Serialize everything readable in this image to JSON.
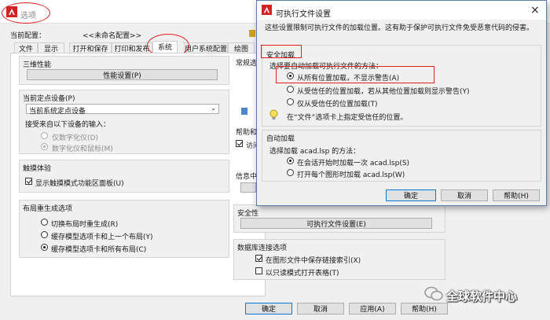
{
  "options": {
    "title": "选项",
    "profile_label": "当前配置：",
    "profile_value": "<<未命名配置>>",
    "tabs": [
      "文件",
      "显示",
      "打开和保存",
      "打印和发布",
      "系统",
      "用户系统配置",
      "绘图"
    ],
    "perf_group": "三维性能",
    "perf_btn": "性能设置(P)",
    "pointer_group": "当前定点设备(P)",
    "pointer_select": "当前系统定点设备",
    "accept_label": "接受来自以下设备的输入：",
    "digitizer_only": "仅数字化仪(D)",
    "digitizer_mouse": "数字化仪和鼠标(M)",
    "touch_group": "触摸体验",
    "touch_check": "显示触摸模式功能区面板(U)",
    "layout_group": "布局重生成选项",
    "layout_opt1": "切换布局时重生成(R)",
    "layout_opt2": "缓存模型选项卡和上一个布局(Y)",
    "layout_opt3": "缓存模型选项卡和所有布局(C)",
    "right_general": "常规选",
    "right_help": "帮助和",
    "right_access": "访问",
    "right_info": "信息中",
    "security_group": "安全性",
    "security_btn": "可执行文件设置(E)",
    "db_group": "数据库连接选项",
    "db_opt1": "在图形文件中保存链接索引(X)",
    "db_opt2": "以只读模式打开表格(T)",
    "ok": "确定",
    "cancel": "取消",
    "apply": "应用(A)",
    "help": "帮助(H)"
  },
  "exec_dialog": {
    "title": "可执行文件设置",
    "close": "×",
    "desc": "这些设置限制可执行文件的加载位置。这有助于保护可执行文件免受恶意代码的侵害。",
    "security_heading": "安全加载",
    "select_label": "选择要自动加载可执行文件的方法：",
    "opt1": "从所有位置加载，不显示警告(A)",
    "opt2": "从受信任的位置加载，若从其他位置加载则显示警告(Y)",
    "opt3": "仅从受信任的位置加载(T)",
    "hint": "在“文件”选项卡上指定受信任的位置。",
    "autoload_heading": "自动加载",
    "autoload_label": "选择加载 acad.lsp 的方法：",
    "autoload_opt1": "在会话开始时加载一次 acad.lsp(S)",
    "autoload_opt2": "打开每个图形时加载 acad.lsp(W)",
    "ok": "确定",
    "cancel": "取消",
    "help": "帮助(H)"
  },
  "watermark": {
    "text": "全球软件中心"
  },
  "colors": {
    "autocad_red": "#d22222",
    "annotation_red": "#e02020",
    "focus_blue": "#0078d7"
  }
}
